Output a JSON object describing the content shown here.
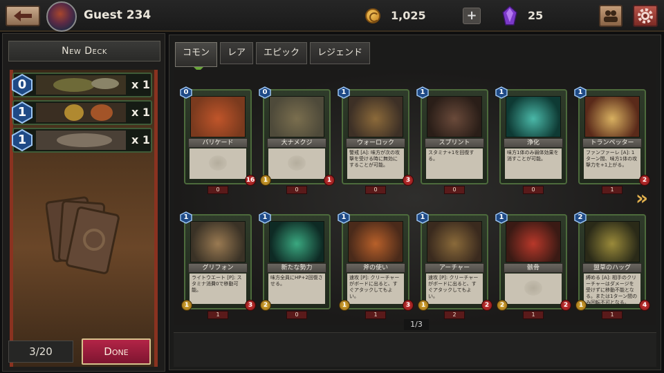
{
  "header": {
    "username": "Guest 234",
    "coins": "1,025",
    "plus_label": "+",
    "gems": "25"
  },
  "deck": {
    "name": "New Deck",
    "items": [
      {
        "cost": "0",
        "qty": "x 1"
      },
      {
        "cost": "1",
        "qty": "x 1"
      },
      {
        "cost": "1",
        "qty": "x 1"
      }
    ],
    "count": "3/20",
    "done_label": "Done"
  },
  "tabs": [
    {
      "label": "コモン",
      "active": true
    },
    {
      "label": "レア",
      "active": false
    },
    {
      "label": "エピック",
      "active": false
    },
    {
      "label": "レジェンド",
      "active": false
    }
  ],
  "cards": [
    {
      "name": "バリケード",
      "cost": "0",
      "atk": "",
      "hp": "16",
      "owned": "0",
      "text": ""
    },
    {
      "name": "大ナメクジ",
      "cost": "0",
      "atk": "1",
      "hp": "1",
      "owned": "0",
      "text": ""
    },
    {
      "name": "ウォーロック",
      "cost": "1",
      "atk": "",
      "hp": "3",
      "owned": "0",
      "text": "警戒 [A]: 味方が次の攻撃を受ける時に無効にすることが可能。"
    },
    {
      "name": "スプリント",
      "cost": "1",
      "atk": "",
      "hp": "",
      "owned": "0",
      "text": "スタミナ+1を回復する。"
    },
    {
      "name": "浄化",
      "cost": "1",
      "atk": "",
      "hp": "",
      "owned": "0",
      "text": "味方1体のみ弱体効果を消すことが可能。"
    },
    {
      "name": "トランペッター",
      "cost": "1",
      "atk": "",
      "hp": "2",
      "owned": "1",
      "text": "ファンファーレ [A]: 1ターン間、味方1体の攻撃力を+1上がる。"
    },
    {
      "name": "グリフォン",
      "cost": "1",
      "atk": "1",
      "hp": "3",
      "owned": "1",
      "text": "ライトウエート [P]: スタミナ消費0で移動可能。"
    },
    {
      "name": "新たな勢力",
      "cost": "1",
      "atk": "2",
      "hp": "",
      "owned": "0",
      "text": "味方全員にHP+2回復させる。"
    },
    {
      "name": "斧の使い",
      "cost": "1",
      "atk": "1",
      "hp": "3",
      "owned": "1",
      "text": "速攻 [P]: クリーチャーがボードに出ると、すぐアタックしてもよい。"
    },
    {
      "name": "アーチャー",
      "cost": "1",
      "atk": "1",
      "hp": "2",
      "owned": "2",
      "text": "速攻 [P]: クリーチャーがボードに出ると、すぐアタックしてもよい。"
    },
    {
      "name": "骸骨",
      "cost": "1",
      "atk": "2",
      "hp": "2",
      "owned": "1",
      "text": ""
    },
    {
      "name": "盟草のハッグ",
      "cost": "2",
      "atk": "1",
      "hp": "4",
      "owned": "1",
      "text": "縛める [A]: 相手のクリーチャーはダメージを受けずに移動不能となる。または1ターン間のみ回転不可となる。"
    }
  ],
  "pager": "1/3",
  "colors": {
    "accent_green": "#4d6b3c",
    "done_red": "#b32447",
    "tab_indicator": "#69a53a",
    "gold": "#e1b04e"
  },
  "icons": {
    "back": "back-arrow-icon",
    "coin": "coin-icon",
    "gem": "gem-icon",
    "friends": "friends-icon",
    "settings": "gear-icon",
    "next": "chevron-right-icon"
  }
}
